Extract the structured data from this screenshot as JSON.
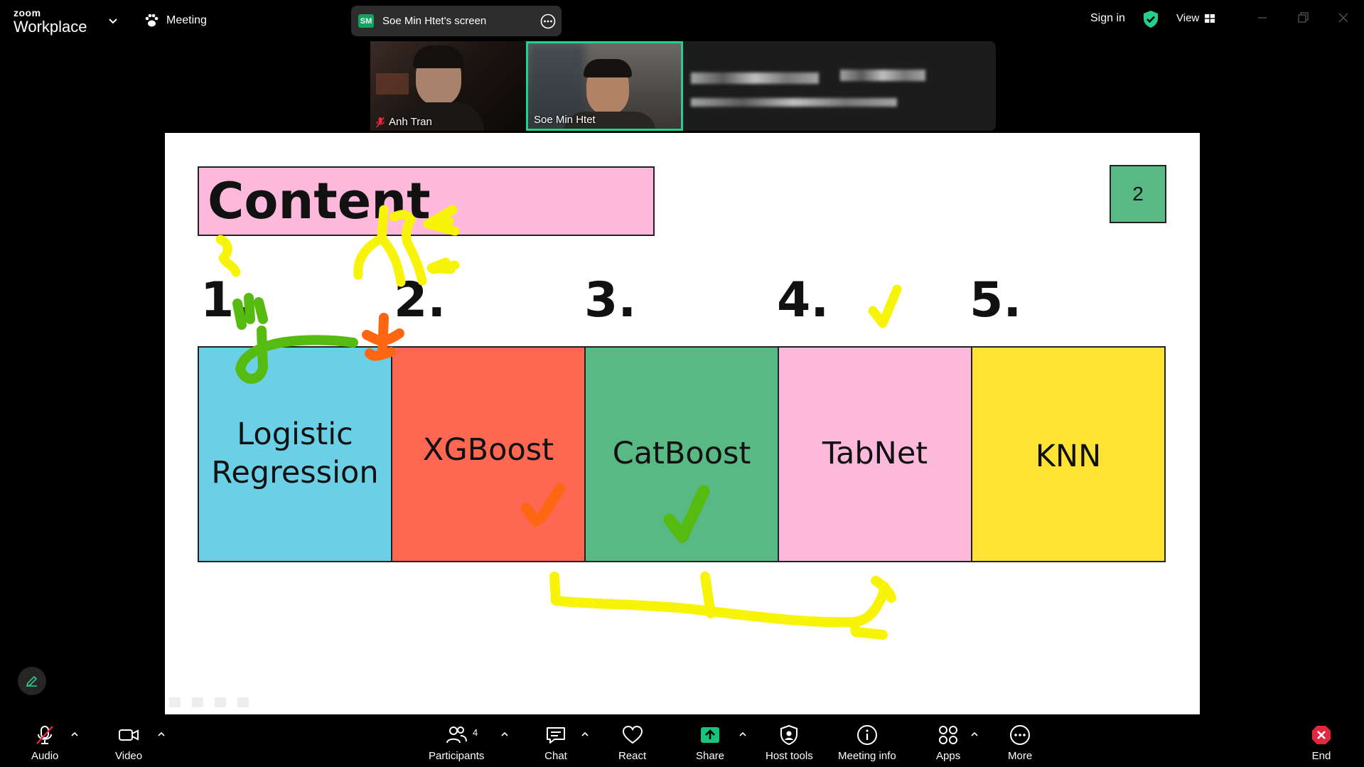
{
  "topbar": {
    "brand_top": "zoom",
    "brand_bottom": "Workplace",
    "meeting_label": "Meeting",
    "share_badge": "SM",
    "share_title": "Soe Min Htet's screen",
    "signin_label": "Sign in",
    "view_label": "View"
  },
  "participants_strip": {
    "tiles": [
      {
        "name": "Anh Tran",
        "muted": true
      },
      {
        "name": "Soe Min Htet",
        "active_speaker": true
      }
    ]
  },
  "slide": {
    "title": "Content",
    "page_number": "2",
    "items": [
      {
        "number": "1.",
        "label": "Logistic Regression",
        "color": "#6bd0e6"
      },
      {
        "number": "2.",
        "label": "XGBoost",
        "color": "#fe6752"
      },
      {
        "number": "3.",
        "label": "CatBoost",
        "color": "#58b985"
      },
      {
        "number": "4.",
        "label": "TabNet",
        "color": "#fdb9dc"
      },
      {
        "number": "5.",
        "label": "KNN",
        "color": "#fee234"
      }
    ]
  },
  "toolbar": {
    "audio": "Audio",
    "video": "Video",
    "participants": "Participants",
    "participants_count": "4",
    "chat": "Chat",
    "react": "React",
    "share": "Share",
    "host_tools": "Host tools",
    "meeting_info": "Meeting info",
    "apps": "Apps",
    "more": "More",
    "end": "End"
  },
  "colors": {
    "accent_green": "#23d18b",
    "share_green": "#19c37d",
    "end_red": "#e5263f",
    "annotation_yellow": "#f7f40a",
    "annotation_green": "#55bb11",
    "annotation_orange": "#ff6611"
  }
}
